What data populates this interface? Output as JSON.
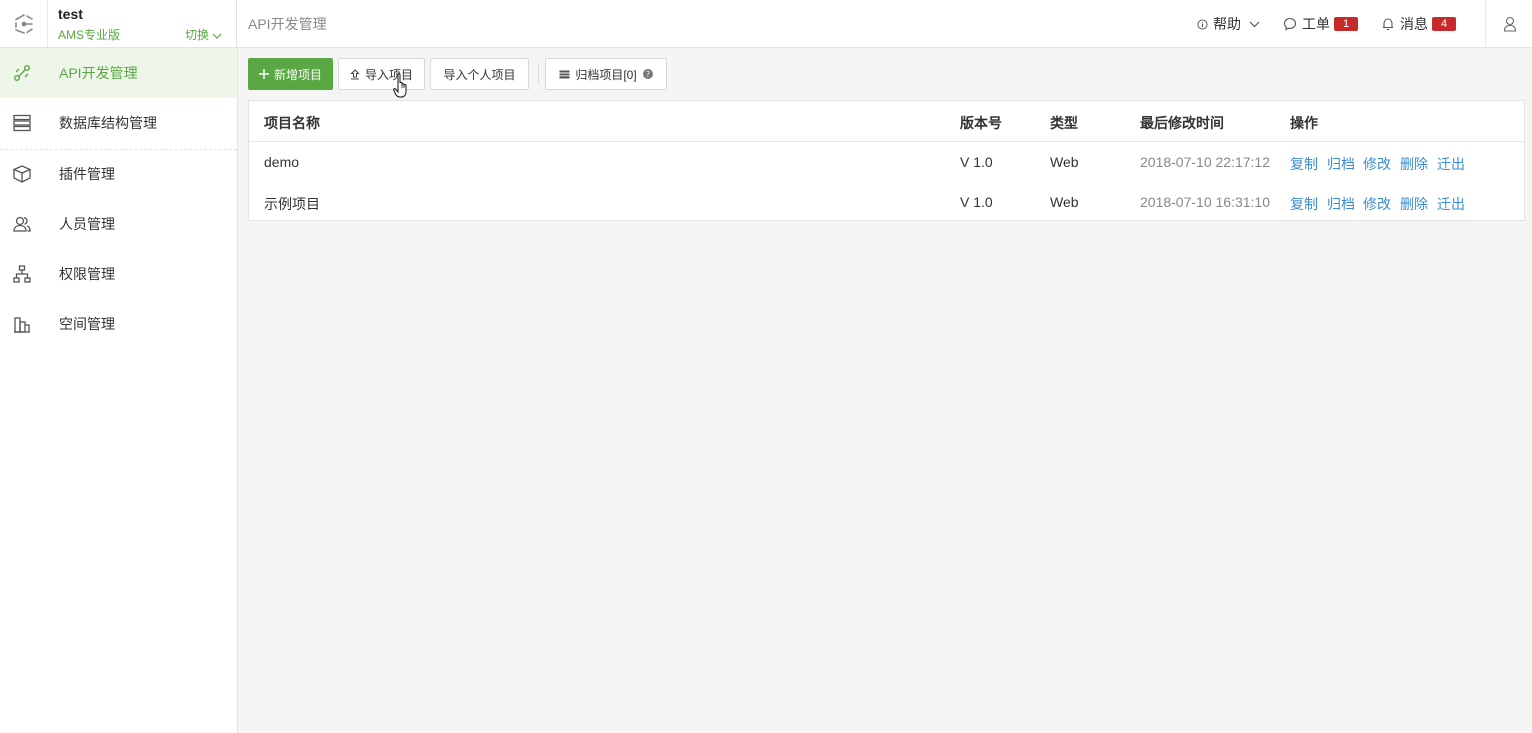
{
  "workspace": {
    "name": "test",
    "edition": "AMS专业版",
    "switch_label": "切换"
  },
  "breadcrumb": "API开发管理",
  "topbar": {
    "help_label": "帮助",
    "ticket_label": "工单",
    "ticket_count": "1",
    "message_label": "消息",
    "message_count": "4"
  },
  "sidebar": {
    "items": [
      {
        "label": "API开发管理",
        "icon": "api-dev-icon"
      },
      {
        "label": "数据库结构管理",
        "icon": "database-icon"
      },
      {
        "label": "插件管理",
        "icon": "plugin-box-icon"
      },
      {
        "label": "人员管理",
        "icon": "users-icon"
      },
      {
        "label": "权限管理",
        "icon": "hierarchy-icon"
      },
      {
        "label": "空间管理",
        "icon": "building-icon"
      }
    ]
  },
  "toolbar": {
    "add_label": "新增项目",
    "import_label": "导入项目",
    "import_personal_label": "导入个人项目",
    "archive_label": "归档项目[0]"
  },
  "table": {
    "headers": {
      "name": "项目名称",
      "version": "版本号",
      "type": "类型",
      "modified": "最后修改时间",
      "actions": "操作"
    },
    "rows": [
      {
        "name": "demo",
        "version": "V 1.0",
        "type": "Web",
        "modified": "2018-07-10 22:17:12"
      },
      {
        "name": "示例项目",
        "version": "V 1.0",
        "type": "Web",
        "modified": "2018-07-10 16:31:10"
      }
    ],
    "actions": {
      "copy": "复制",
      "archive": "归档",
      "edit": "修改",
      "delete": "删除",
      "move_out": "迁出"
    }
  },
  "colors": {
    "accent": "#5aa843",
    "link": "#3b8fd4",
    "badge": "#c72a2a"
  }
}
